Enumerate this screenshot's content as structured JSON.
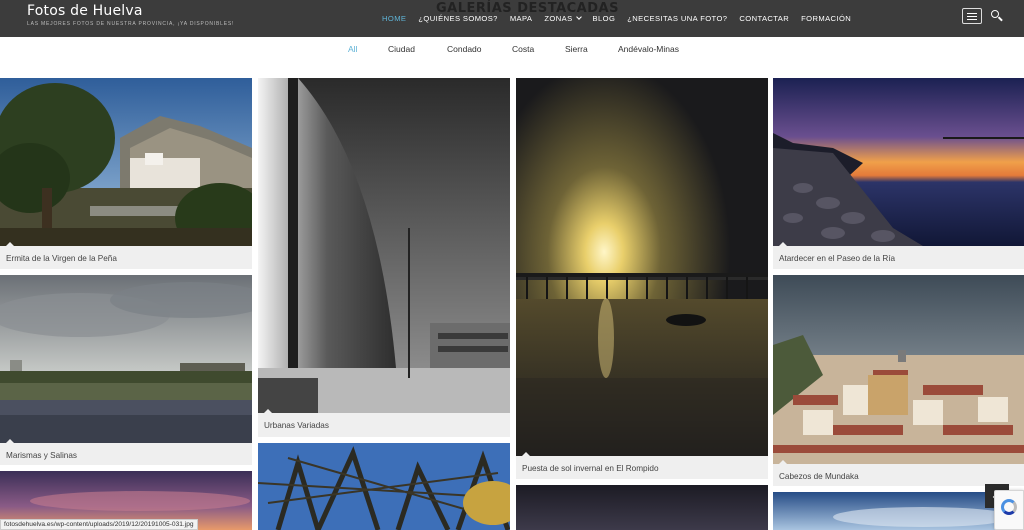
{
  "site": {
    "title": "Fotos de Huelva",
    "tagline": "LAS MEJORES FOTOS DE NUESTRA PROVINCIA, ¡YA DISPONIBLES!"
  },
  "nav": {
    "items": [
      {
        "label": "HOME",
        "active": true
      },
      {
        "label": "¿QUIÉNES SOMOS?"
      },
      {
        "label": "MAPA"
      },
      {
        "label": "ZONAS",
        "dropdown": true
      },
      {
        "label": "BLOG"
      },
      {
        "label": "¿NECESITAS UNA FOTO?"
      },
      {
        "label": "CONTACTAR"
      },
      {
        "label": "FORMACIÓN"
      }
    ],
    "menu_icon": "hamburger-icon",
    "search_icon": "search-icon"
  },
  "section": {
    "title": "GALERÍAS DESTACADAS"
  },
  "filters": [
    "All",
    "Ciudad",
    "Condado",
    "Costa",
    "Sierra",
    "Andévalo-Minas"
  ],
  "active_filter": "All",
  "gallery": {
    "col1": [
      {
        "caption": "Ermita de la Virgen de la Peña",
        "scene": "hill-village"
      },
      {
        "caption": "Marismas y Salinas",
        "scene": "marsh"
      },
      {
        "caption": "",
        "scene": "purple-sky"
      }
    ],
    "col2": [
      {
        "caption": "Urbanas Variadas",
        "scene": "bw-building"
      },
      {
        "caption": "",
        "scene": "trees"
      }
    ],
    "col3": [
      {
        "caption": "Puesta de sol invernal en El Rompido",
        "scene": "pier-sunset"
      },
      {
        "caption": "",
        "scene": "dark-sky"
      }
    ],
    "col4": [
      {
        "caption": "Atardecer en el Paseo de la Ría",
        "scene": "river-dusk"
      },
      {
        "caption": "Cabezos de Mundaka",
        "scene": "rooftops"
      },
      {
        "caption": "",
        "scene": "blue-sky"
      }
    ]
  },
  "status_bar": "fotosdehuelva.es/wp-content/uploads/2019/12/20191005-031.jpg",
  "back_to_top_icon": "chevron-up-icon",
  "colors": {
    "header_bg": "#3c3c3c",
    "accent": "#5fb3d6",
    "caption_bg": "#efefef"
  }
}
